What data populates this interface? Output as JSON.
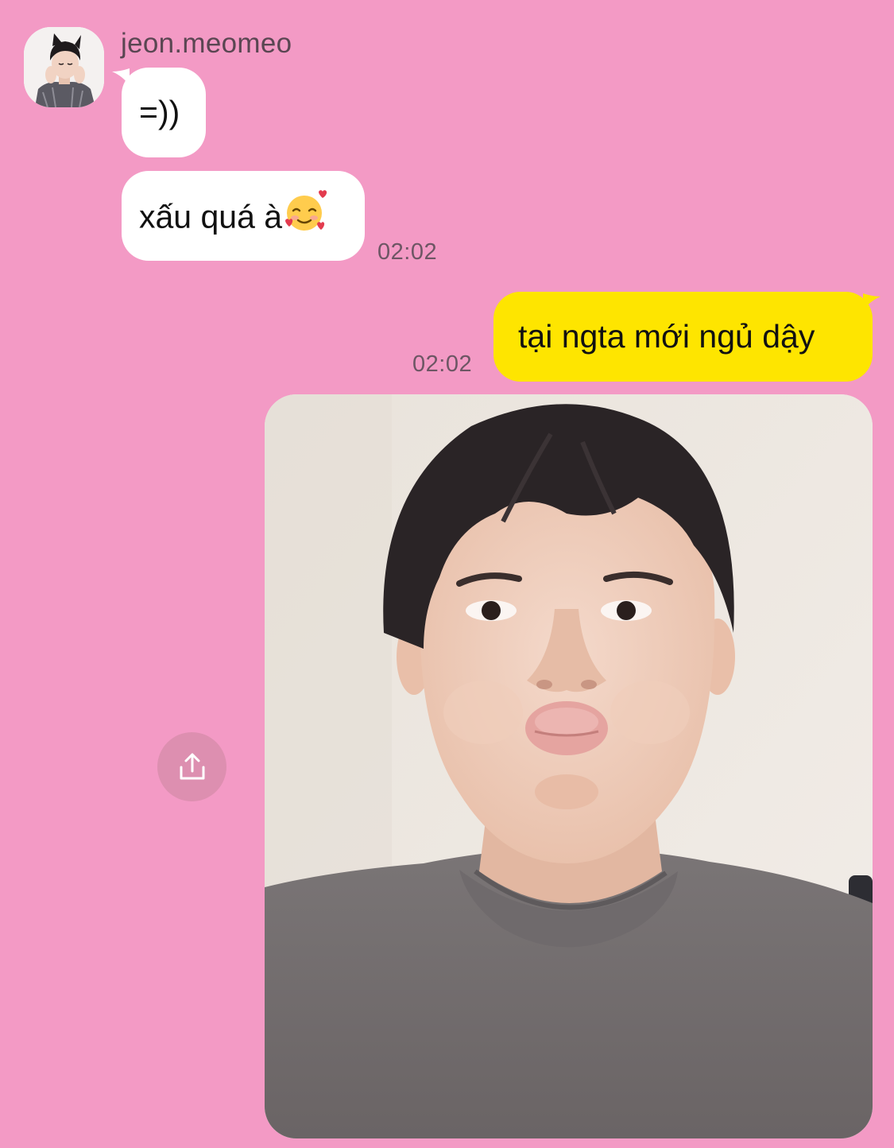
{
  "colors": {
    "background": "#F39AC5",
    "incoming_bubble": "#FFFFFF",
    "outgoing_bubble": "#FEE500",
    "share_button": "#DD8FB0"
  },
  "conversation": {
    "sender": {
      "name": "jeon.meomeo",
      "avatar_icon": "profile-photo"
    },
    "messages": [
      {
        "direction": "incoming",
        "text": "=))"
      },
      {
        "direction": "incoming",
        "text": "xấu quá à",
        "emoji": "smiling-face-with-hearts",
        "time": "02:02"
      },
      {
        "direction": "outgoing",
        "text": "tại ngta mới ngủ dậy",
        "time": "02:02"
      }
    ],
    "photo": {
      "type": "image",
      "share_icon": "share-icon"
    }
  }
}
